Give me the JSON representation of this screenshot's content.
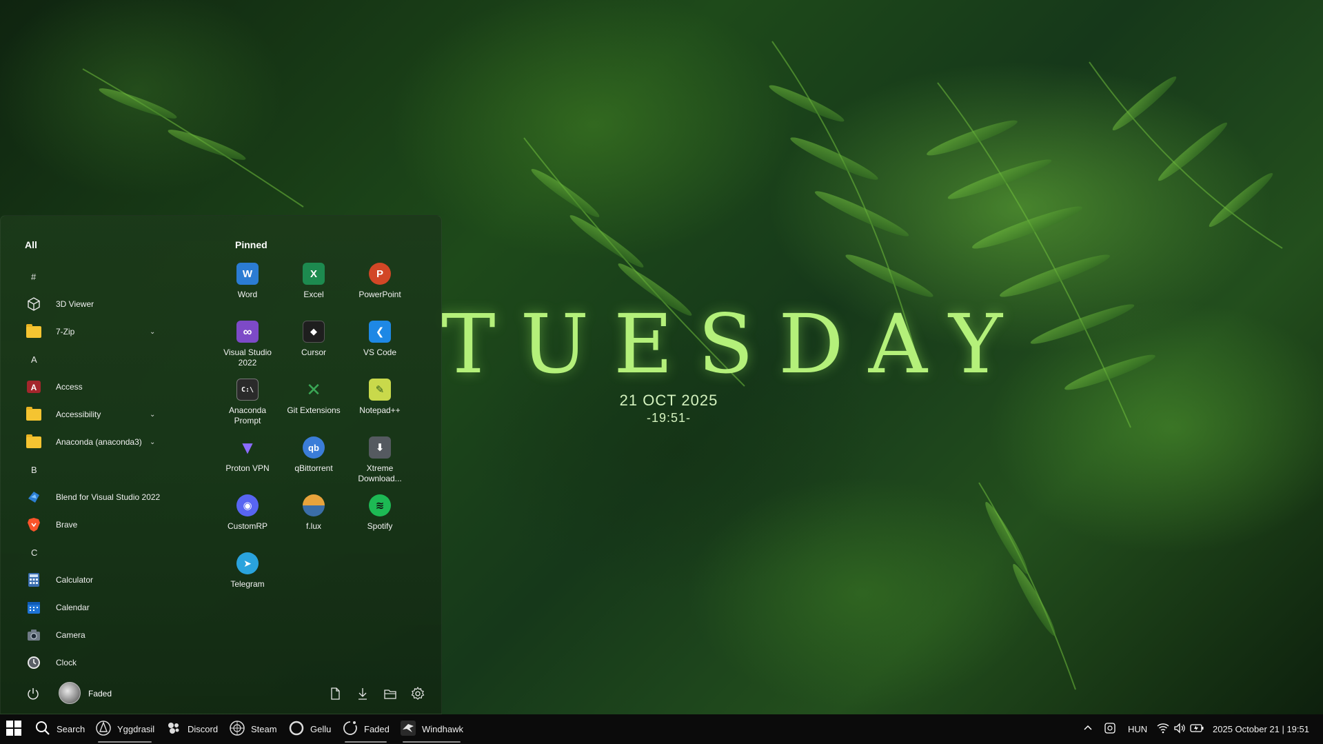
{
  "desktop": {
    "day": "TUESDAY",
    "date": "21 OCT 2025",
    "time": "-19:51-"
  },
  "start_menu": {
    "all_header": "All",
    "pinned_header": "Pinned",
    "app_list": [
      {
        "type": "letter",
        "label": "#"
      },
      {
        "type": "app",
        "label": "3D Viewer",
        "icon": "cube-icon"
      },
      {
        "type": "folder",
        "label": "7-Zip",
        "icon": "folder-icon"
      },
      {
        "type": "letter",
        "label": "A"
      },
      {
        "type": "app",
        "label": "Access",
        "icon": "access-icon"
      },
      {
        "type": "folder",
        "label": "Accessibility",
        "icon": "folder-icon"
      },
      {
        "type": "folder",
        "label": "Anaconda (anaconda3)",
        "icon": "folder-icon"
      },
      {
        "type": "letter",
        "label": "B"
      },
      {
        "type": "app",
        "label": "Blend for Visual Studio 2022",
        "icon": "blend-icon"
      },
      {
        "type": "app",
        "label": "Brave",
        "icon": "brave-icon"
      },
      {
        "type": "letter",
        "label": "C"
      },
      {
        "type": "app",
        "label": "Calculator",
        "icon": "calculator-icon"
      },
      {
        "type": "app",
        "label": "Calendar",
        "icon": "calendar-icon"
      },
      {
        "type": "app",
        "label": "Camera",
        "icon": "camera-icon"
      },
      {
        "type": "app",
        "label": "Clock",
        "icon": "clock-icon"
      }
    ],
    "pinned": [
      {
        "label": "Word",
        "icon": "word-icon",
        "color": "#2b7cd3",
        "glyph": "W"
      },
      {
        "label": "Excel",
        "icon": "excel-icon",
        "color": "#1d8a4f",
        "glyph": "X"
      },
      {
        "label": "PowerPoint",
        "icon": "powerpoint-icon",
        "color": "#d24726",
        "glyph": "P"
      },
      {
        "label": "Visual Studio 2022",
        "icon": "visual-studio-icon",
        "color": "#7d4ac7",
        "glyph": "∞"
      },
      {
        "label": "Cursor",
        "icon": "cursor-icon",
        "color": "#1e1e1e",
        "glyph": "◆"
      },
      {
        "label": "VS Code",
        "icon": "vscode-icon",
        "color": "#1e88e5",
        "glyph": "❮"
      },
      {
        "label": "Anaconda Prompt",
        "icon": "anaconda-prompt-icon",
        "color": "#2a2a2a",
        "glyph": "C:\\"
      },
      {
        "label": "Git Extensions",
        "icon": "git-extensions-icon",
        "color": "#3aa655",
        "glyph": "✕"
      },
      {
        "label": "Notepad++",
        "icon": "notepadpp-icon",
        "color": "#c9d94b",
        "glyph": "✎"
      },
      {
        "label": "Proton VPN",
        "icon": "proton-vpn-icon",
        "color": "#6d4aff",
        "glyph": "▼"
      },
      {
        "label": "qBittorrent",
        "icon": "qbittorrent-icon",
        "color": "#3b7dd8",
        "glyph": "qb"
      },
      {
        "label": "Xtreme Download...",
        "icon": "xtreme-download-icon",
        "color": "#555a60",
        "glyph": "⬇"
      },
      {
        "label": "CustomRP",
        "icon": "customrp-icon",
        "color": "#5865f2",
        "glyph": "◉"
      },
      {
        "label": "f.lux",
        "icon": "flux-icon",
        "color": "#e8a33c",
        "glyph": "◐"
      },
      {
        "label": "Spotify",
        "icon": "spotify-icon",
        "color": "#1db954",
        "glyph": "≋"
      },
      {
        "label": "Telegram",
        "icon": "telegram-icon",
        "color": "#2aa3dd",
        "glyph": "➤"
      }
    ],
    "user_name": "Faded"
  },
  "taskbar": {
    "items": [
      {
        "label": "Search",
        "icon": "search-icon"
      },
      {
        "label": "Yggdrasil",
        "icon": "yggdrasil-icon"
      },
      {
        "label": "Discord",
        "icon": "discord-icon"
      },
      {
        "label": "Steam",
        "icon": "steam-icon"
      },
      {
        "label": "Gellu",
        "icon": "gellu-icon"
      },
      {
        "label": "Faded",
        "icon": "faded-icon"
      },
      {
        "label": "Windhawk",
        "icon": "windhawk-icon"
      }
    ],
    "language": "HUN",
    "clock": "2025 October 21 | 19:51"
  }
}
